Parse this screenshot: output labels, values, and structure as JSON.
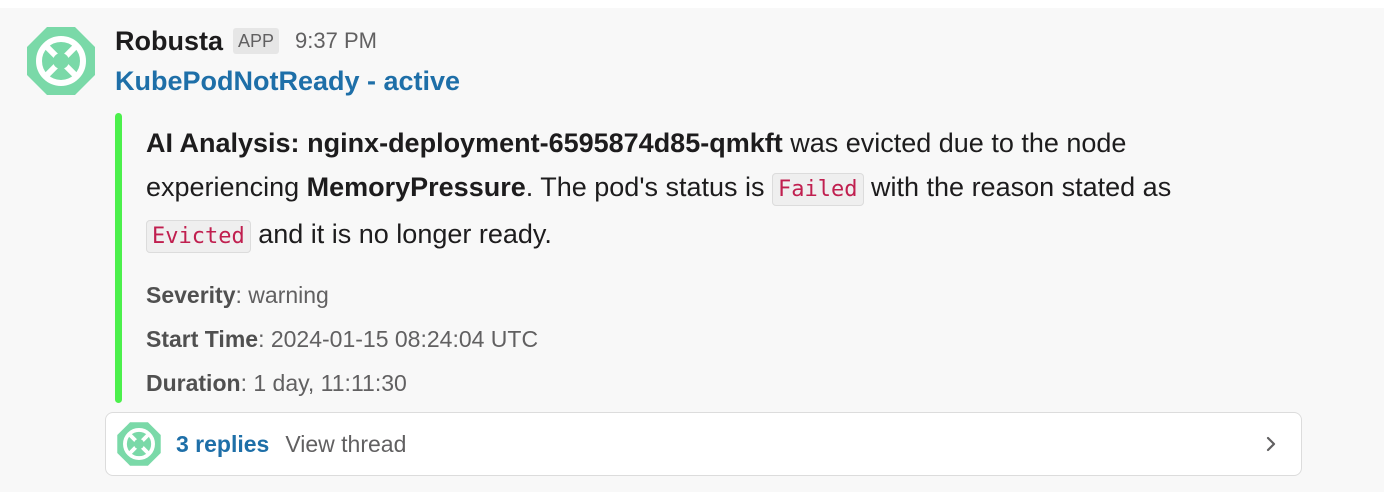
{
  "message": {
    "sender": "Robusta",
    "app_badge": "APP",
    "timestamp": "9:37 PM",
    "avatar_icon": "robusta-logo-icon",
    "title": "KubePodNotReady - active"
  },
  "attachment": {
    "bar_color": "#4cf04c",
    "ai_label": "AI Analysis:",
    "pod_name": "nginx-deployment-6595874d85-qmkft",
    "text_1": " was evicted due to the node experiencing ",
    "pressure": "MemoryPressure",
    "text_2": ". The pod's status is ",
    "status_code": "Failed",
    "text_3": " with the reason stated as ",
    "reason_code": "Evicted",
    "text_4": " and it is no longer ready.",
    "fields": [
      {
        "label": "Severity",
        "value": ": warning"
      },
      {
        "label": "Start Time",
        "value": ": 2024-01-15 08:24:04 UTC"
      },
      {
        "label": "Duration",
        "value": ": 1 day, 11:11:30"
      }
    ]
  },
  "thread": {
    "replies": "3 replies",
    "view": "View thread",
    "chevron_icon": "chevron-right-icon"
  },
  "colors": {
    "link": "#1e6fa8",
    "logo": "#7ad9a8",
    "code_text": "#c01f4f"
  }
}
